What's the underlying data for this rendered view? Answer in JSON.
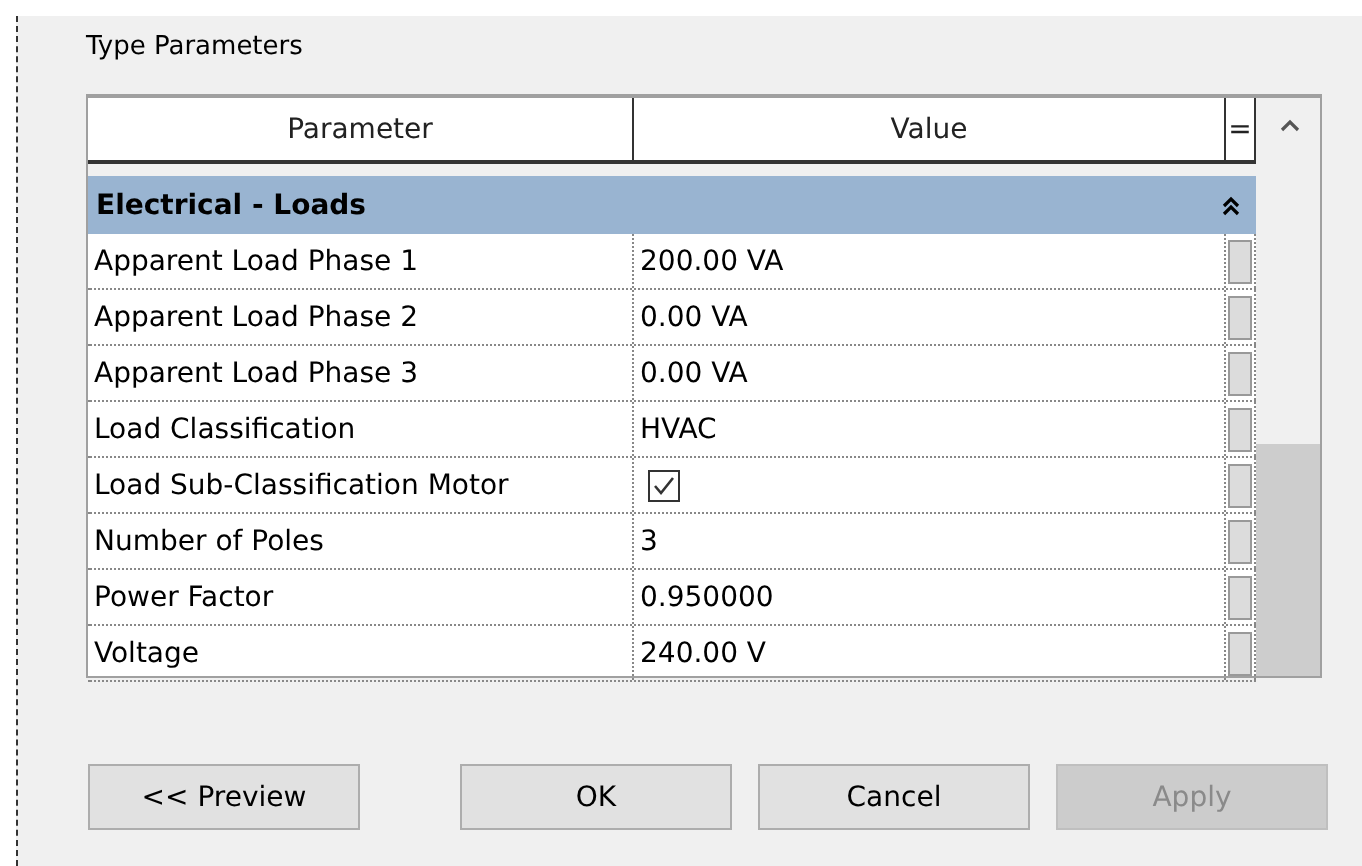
{
  "panel": {
    "title": "Type Parameters"
  },
  "table": {
    "columns": [
      "Parameter",
      "Value",
      "="
    ],
    "group": {
      "label": "Electrical - Loads",
      "expanded": true
    },
    "rows": [
      {
        "name": "Apparent Load Phase 1",
        "kind": "text",
        "value": "200.00 VA"
      },
      {
        "name": "Apparent Load Phase 2",
        "kind": "text",
        "value": "0.00 VA"
      },
      {
        "name": "Apparent Load Phase 3",
        "kind": "text",
        "value": "0.00 VA"
      },
      {
        "name": "Load Classification",
        "kind": "text",
        "value": "HVAC"
      },
      {
        "name": "Load Sub-Classification Motor",
        "kind": "checkbox",
        "checked": true
      },
      {
        "name": "Number of Poles",
        "kind": "text",
        "value": "3"
      },
      {
        "name": "Power Factor",
        "kind": "text",
        "value": "0.950000"
      },
      {
        "name": "Voltage",
        "kind": "text",
        "value": "240.00 V"
      }
    ]
  },
  "buttons": [
    {
      "label": "<< Preview",
      "disabled": false
    },
    {
      "label": "OK",
      "disabled": false
    },
    {
      "label": "Cancel",
      "disabled": false
    },
    {
      "label": "Apply",
      "disabled": true
    }
  ]
}
